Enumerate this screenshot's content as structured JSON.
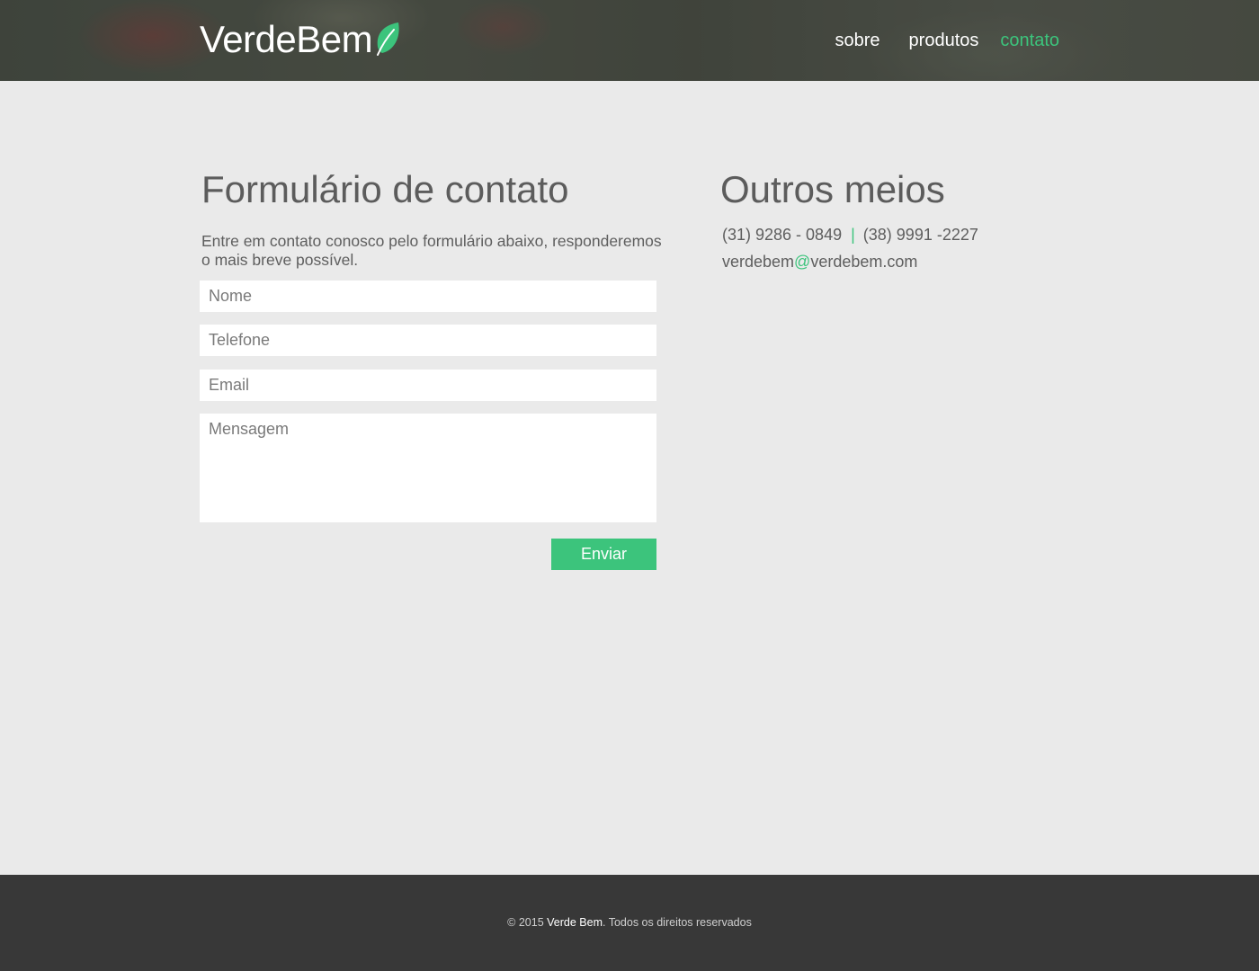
{
  "header": {
    "logo": {
      "part1": "Verde",
      "part2": "Bem",
      "icon": "leaf-icon"
    },
    "nav": [
      {
        "label": "sobre",
        "active": false
      },
      {
        "label": "produtos",
        "active": false
      },
      {
        "label": "contato",
        "active": true
      }
    ]
  },
  "form": {
    "title": "Formulário de contato",
    "intro": "Entre em contato conosco pelo formulário abaixo, responderemos o mais breve possível.",
    "fields": {
      "nome": {
        "placeholder": "Nome",
        "value": ""
      },
      "telefone": {
        "placeholder": "Telefone",
        "value": ""
      },
      "email": {
        "placeholder": "Email",
        "value": ""
      },
      "mensagem": {
        "placeholder": "Mensagem",
        "value": ""
      }
    },
    "submit_label": "Enviar"
  },
  "other": {
    "title": "Outros meios",
    "phone1": "(31) 9286 - 0849",
    "separator": "|",
    "phone2": "(38) 9991 -2227",
    "email_user": "verdebem",
    "email_at": "@",
    "email_domain": "verdebem.com"
  },
  "footer": {
    "copyright": "© 2015",
    "brand": "Verde Bem",
    "rights": ". Todos os direitos reservados"
  },
  "colors": {
    "accent": "#3cc47c",
    "background": "#eaeaea",
    "footer": "#383838"
  }
}
